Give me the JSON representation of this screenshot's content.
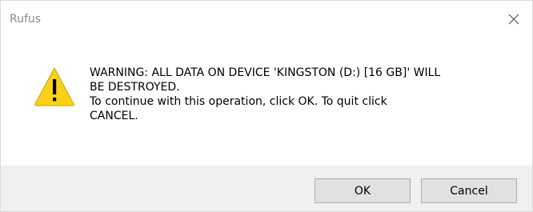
{
  "window": {
    "title": "Rufus",
    "close_icon": "close-icon"
  },
  "message": {
    "icon": "warning-icon",
    "lines": [
      "WARNING: ALL DATA ON DEVICE 'KINGSTON (D:) [16 GB]' WILL",
      "BE DESTROYED.",
      "To continue with this operation, click OK. To quit click",
      "CANCEL."
    ]
  },
  "buttons": {
    "ok_label": "OK",
    "cancel_label": "Cancel"
  },
  "colors": {
    "title_text": "#8c8c8c",
    "warning_yellow": "#fcd116",
    "footer_bg": "#f0f0f0",
    "button_bg": "#e1e1e1",
    "button_border": "#adadad"
  }
}
